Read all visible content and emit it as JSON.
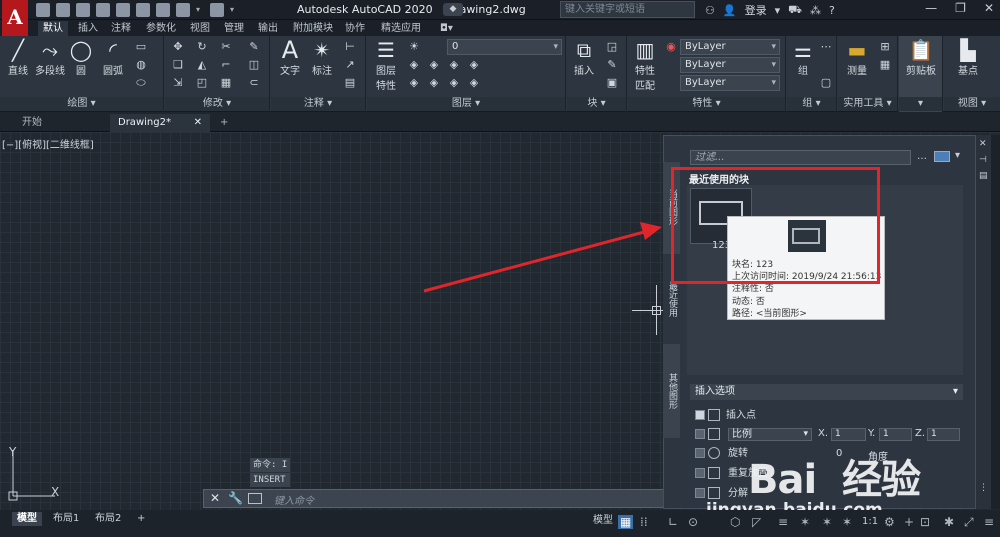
{
  "app": {
    "title": "Autodesk AutoCAD 2020    Drawing2.dwg",
    "logo": "A",
    "search_placeholder": "键入关键字或短语",
    "login": "登录"
  },
  "ribbon_tabs": [
    "默认",
    "插入",
    "注释",
    "参数化",
    "视图",
    "管理",
    "输出",
    "附加模块",
    "协作",
    "精选应用"
  ],
  "panels": {
    "draw": {
      "title": "绘图 ▾",
      "tools": [
        "直线",
        "多段线",
        "圆",
        "圆弧"
      ]
    },
    "modify": {
      "title": "修改 ▾"
    },
    "annotation": {
      "title": "注释 ▾",
      "tools": [
        "文字",
        "标注"
      ]
    },
    "layers": {
      "title": "图层 ▾",
      "tool": "图层\n特性",
      "layer_value": "0"
    },
    "block": {
      "title": "块 ▾",
      "tool": "插入"
    },
    "properties": {
      "title": "特性 ▾",
      "tool": "特性\n匹配",
      "bylayer": [
        "ByLayer",
        "ByLayer",
        "ByLayer"
      ]
    },
    "groups": {
      "title": "组 ▾",
      "tool": "组"
    },
    "utilities": {
      "title": "实用工具 ▾",
      "tool": "测量"
    },
    "clipboard": {
      "title": "▾",
      "tool": "剪贴板"
    },
    "view": {
      "title": "视图 ▾",
      "tool": "基点"
    }
  },
  "file_tabs": [
    "开始",
    "Drawing2*",
    "+"
  ],
  "viewport_label": "[−][俯视][二维线框]",
  "palette": {
    "filter_placeholder": "过滤...",
    "recent_title": "最近使用的块",
    "side_tabs": [
      "当前图形",
      "最近使用",
      "其他图形"
    ],
    "block_name": "123",
    "tooltip": {
      "lines": [
        "块名: 123",
        "上次访问时间: 2019/9/24 21:56:13",
        "注释性: 否",
        "动态: 否",
        "路径: <当前图形>"
      ]
    },
    "options_title": "插入选项",
    "options": {
      "insert_point": "插入点",
      "scale": "比例",
      "rotate": "旋转",
      "repeat": "重复放置",
      "explode": "分解",
      "x_label": "X.",
      "y_label": "Y.",
      "z_label": "Z.",
      "x_value": "1",
      "y_value": "1",
      "z_value": "1",
      "angle_label": "角度",
      "angle_value": "0"
    }
  },
  "command": {
    "history": [
      "命令: I",
      "INSERT"
    ],
    "placeholder": "键入命令"
  },
  "axis": {
    "x": "X",
    "y": "Y"
  },
  "status": {
    "layouts": [
      "模型",
      "布局1",
      "布局2",
      "+"
    ],
    "model_button": "模型",
    "scale": "1:1"
  },
  "watermark": {
    "brand": "Bai  经验",
    "url": "jingyan.baidu.com"
  },
  "colors": {
    "accent_red": "#e0262a",
    "bg": "#212830"
  }
}
